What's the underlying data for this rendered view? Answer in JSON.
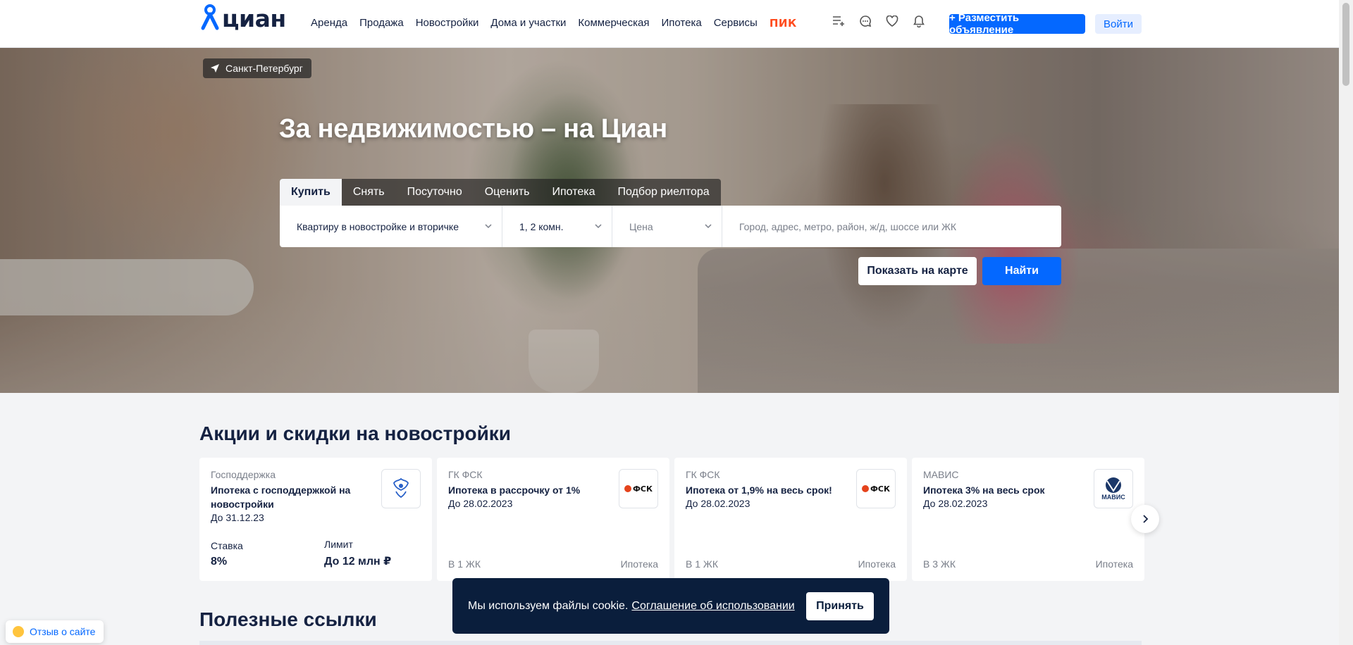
{
  "header": {
    "logo_text": "циан",
    "nav": [
      "Аренда",
      "Продажа",
      "Новостройки",
      "Дома и участки",
      "Коммерческая",
      "Ипотека",
      "Сервисы"
    ],
    "nav_pik": "ПИК",
    "icons": [
      "compare-list-icon",
      "chat-icon",
      "heart-icon",
      "bell-icon"
    ],
    "post_button": "+ Разместить объявление",
    "login_button": "Войти"
  },
  "hero": {
    "city": "Санкт-Петербург",
    "title": "За недвижимостью – на Циан",
    "tabs": [
      "Купить",
      "Снять",
      "Посуточно",
      "Оценить",
      "Ипотека",
      "Подбор риелтора"
    ],
    "active_tab": "Купить",
    "search": {
      "type": "Квартиру в новостройке и вторичке",
      "rooms": "1, 2 комн.",
      "price": "Цена",
      "placeholder": "Город, адрес, метро, район, ж/д, шоссе или ЖК"
    },
    "map_button": "Показать на карте",
    "find_button": "Найти"
  },
  "promos": {
    "title": "Акции и скидки на новостройки",
    "cards": [
      {
        "brand": "Господдержка",
        "headline": "Ипотека с господдержкой на новостройки",
        "date": "До 31.12.23",
        "stat1_label": "Ставка",
        "stat1_value": "8%",
        "stat2_label": "Лимит",
        "stat2_value": "До 12 млн ₽"
      },
      {
        "brand": "ГК ФСК",
        "headline": "Ипотека в рассрочку от 1%",
        "date": "До 28.02.2023",
        "foot_left": "В 1 ЖК",
        "foot_right": "Ипотека",
        "logo_text": "ФСК"
      },
      {
        "brand": "ГК ФСК",
        "headline": "Ипотека от 1,9% на весь срок!",
        "date": "До 28.02.2023",
        "foot_left": "В 1 ЖК",
        "foot_right": "Ипотека",
        "logo_text": "ФСК"
      },
      {
        "brand": "МАВИС",
        "headline": "Ипотека 3% на весь срок",
        "date": "До 28.02.2023",
        "foot_left": "В 3 ЖК",
        "foot_right": "Ипотека",
        "logo_text": "МАВИС"
      }
    ]
  },
  "links": {
    "title": "Полезные ссылки"
  },
  "cookie": {
    "text": "Мы используем файлы cookie.",
    "link": "Соглашение об использовании",
    "accept": "Принять"
  },
  "feedback": "Отзыв о сайте",
  "colors": {
    "brand": "#0468ff",
    "pik": "#ff4c1f",
    "dark": "#152242",
    "cookie_bg": "#0a1e3c"
  }
}
